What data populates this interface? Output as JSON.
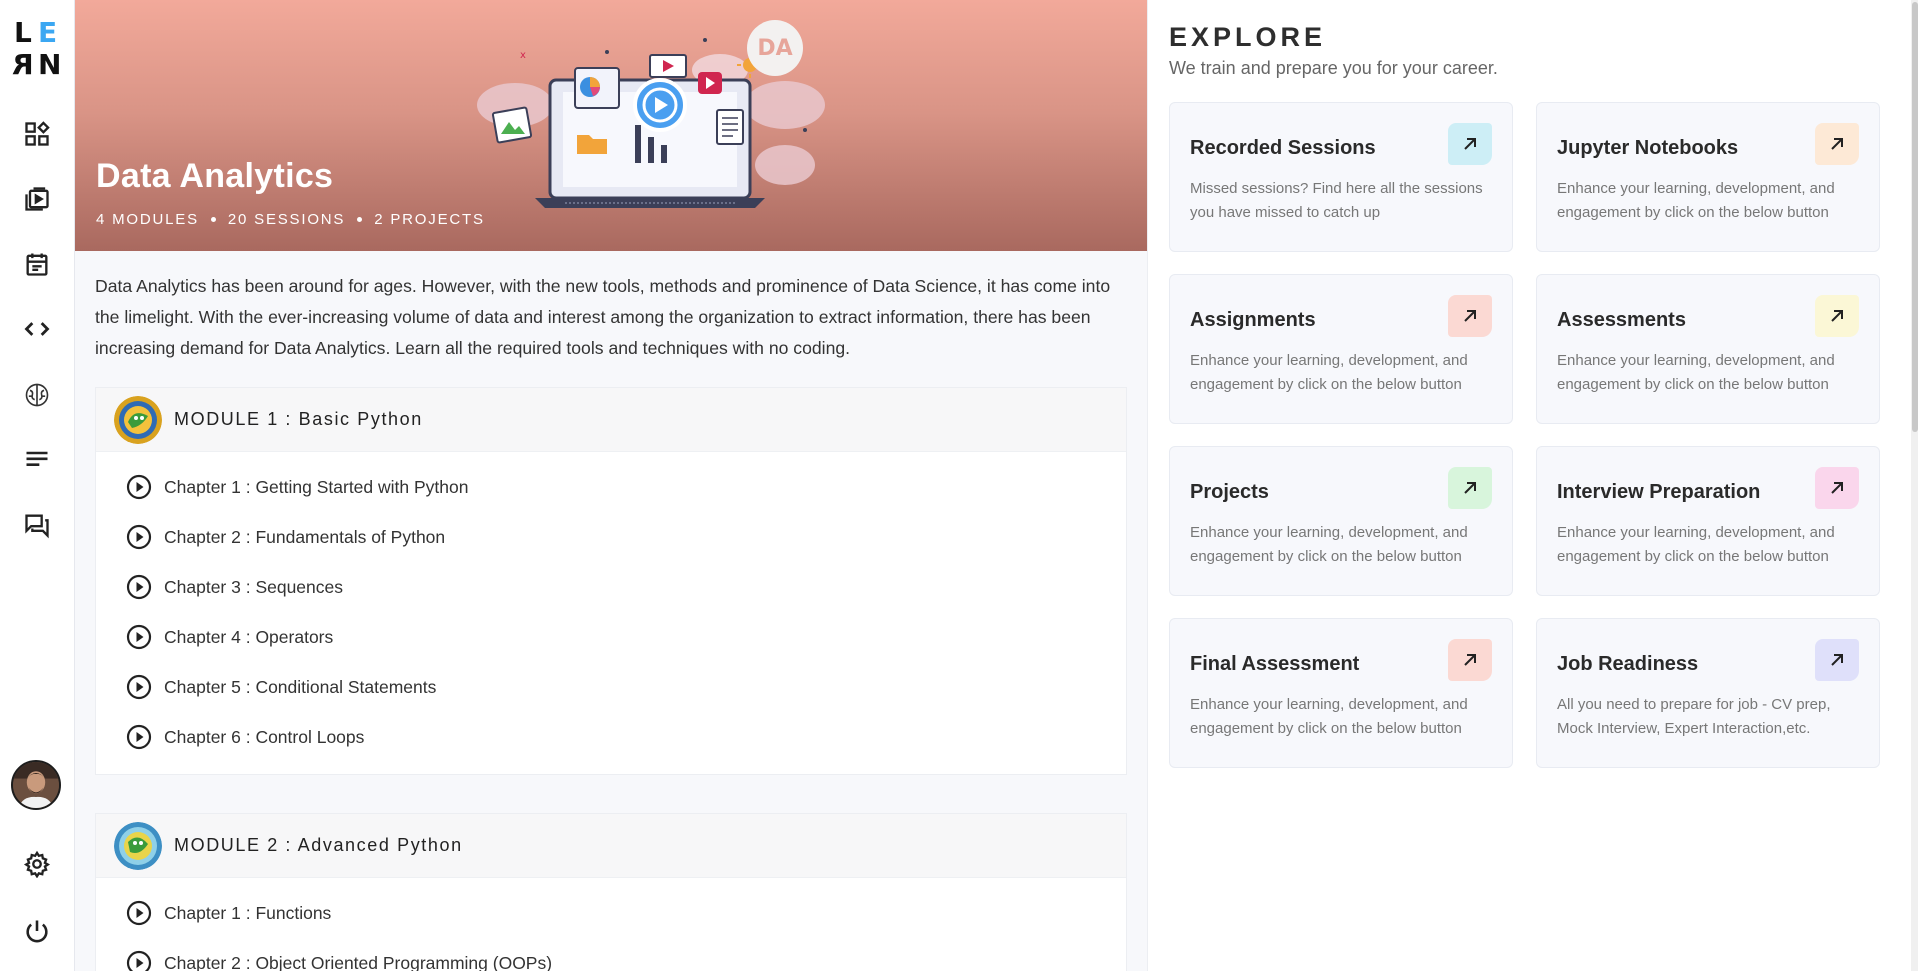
{
  "sidebar": {
    "logo": [
      "L",
      "E",
      "R",
      "N"
    ],
    "items": [
      {
        "icon": "dashboard-icon"
      },
      {
        "icon": "video-library-icon"
      },
      {
        "icon": "calendar-icon"
      },
      {
        "icon": "code-icon"
      },
      {
        "icon": "brain-icon"
      },
      {
        "icon": "notes-icon"
      },
      {
        "icon": "chat-icon"
      }
    ],
    "bottom": [
      {
        "icon": "avatar"
      },
      {
        "icon": "settings-icon"
      },
      {
        "icon": "power-icon"
      }
    ]
  },
  "hero": {
    "badge": "DA",
    "title": "Data Analytics",
    "modules": "4 MODULES",
    "sessions": "20 SESSIONS",
    "projects": "2 PROJECTS"
  },
  "description": "Data Analytics has been around for ages. However, with the new tools, methods and prominence of Data Science, it has come into the limelight. With the ever-increasing volume of data and interest among the organization to extract information, there has been increasing demand for Data Analytics. Learn all the required tools and techniques with no coding.",
  "modules": [
    {
      "title": "MODULE 1 : Basic Python",
      "chapters": [
        "Chapter 1 : Getting Started with Python",
        "Chapter 2 : Fundamentals of Python",
        "Chapter 3 : Sequences",
        "Chapter 4 : Operators",
        "Chapter 5 : Conditional Statements",
        "Chapter 6 : Control Loops"
      ]
    },
    {
      "title": "MODULE 2 : Advanced Python",
      "chapters": [
        "Chapter 1 : Functions",
        "Chapter 2 : Object Oriented Programming (OOPs)"
      ]
    }
  ],
  "explore": {
    "title": "EXPLORE",
    "subtitle": "We train and prepare you for your career.",
    "cards": [
      {
        "title": "Recorded Sessions",
        "desc": "Missed sessions? Find here all the sessions you have missed to catch up",
        "accent": "#cdeef6"
      },
      {
        "title": "Jupyter Notebooks",
        "desc": "Enhance your learning, development, and engagement by click on the below button",
        "accent": "#fde9d6"
      },
      {
        "title": "Assignments",
        "desc": "Enhance your learning, development, and engagement by click on the below button",
        "accent": "#fbd9d3"
      },
      {
        "title": "Assessments",
        "desc": "Enhance your learning, development, and engagement by click on the below button",
        "accent": "#fbf7d6"
      },
      {
        "title": "Projects",
        "desc": "Enhance your learning, development, and engagement by click on the below button",
        "accent": "#d8f5dc"
      },
      {
        "title": "Interview Preparation",
        "desc": "Enhance your learning, development, and engagement by click on the below button",
        "accent": "#fad6ec"
      },
      {
        "title": "Final Assessment",
        "desc": "Enhance your learning, development, and engagement by click on the below button",
        "accent": "#fbd9d3"
      },
      {
        "title": "Job Readiness",
        "desc": "All you need to prepare for job - CV prep, Mock Interview, Expert Interaction,etc.",
        "accent": "#dfe0fa"
      }
    ]
  }
}
